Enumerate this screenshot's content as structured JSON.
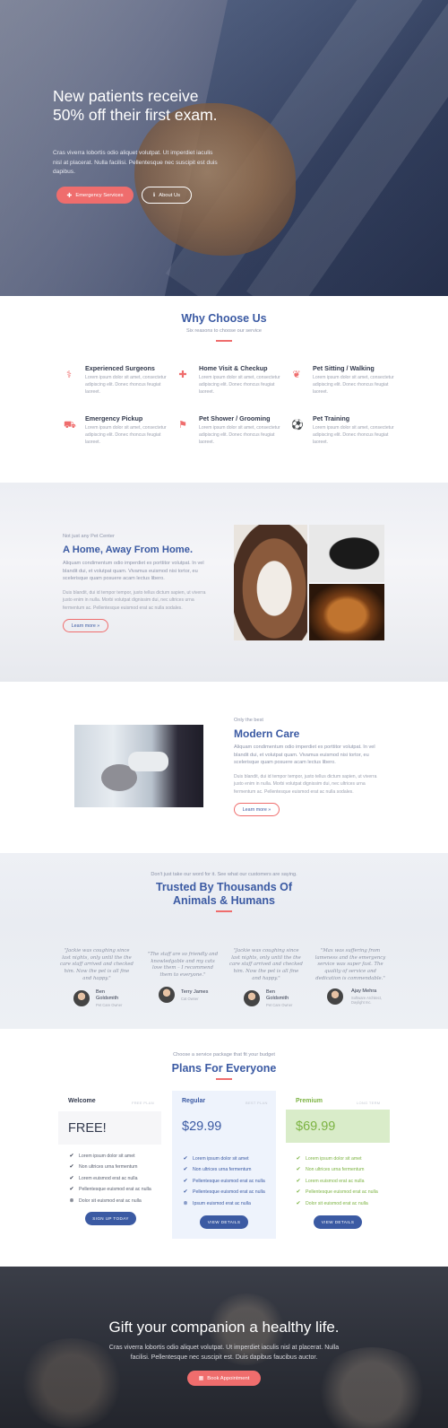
{
  "hero": {
    "title": "New patients receive 50% off their first exam.",
    "text": "Cras viverra lobortis odio aliquet volutpat. Ut imperdiet iaculis nisl at placerat. Nulla facilisi. Pellentesque nec suscipit est duis dapibus.",
    "btn_primary": "Emergency Services",
    "btn_secondary": "About Us"
  },
  "why": {
    "title": "Why Choose Us",
    "subtitle": "Six reasons to choose our service",
    "features": [
      {
        "icon": "stethoscope-icon",
        "title": "Experienced Surgeons",
        "text": "Lorem ipsum dolor sit amet, consectetur adipiscing elit. Donec rhoncus feugiat laoreet."
      },
      {
        "icon": "medical-kit-icon",
        "title": "Home Visit & Checkup",
        "text": "Lorem ipsum dolor sit amet, consectetur adipiscing elit. Donec rhoncus feugiat laoreet."
      },
      {
        "icon": "paw-icon",
        "title": "Pet Sitting / Walking",
        "text": "Lorem ipsum dolor sit amet, consectetur adipiscing elit. Donec rhoncus feugiat laoreet."
      },
      {
        "icon": "ambulance-icon",
        "title": "Emergency Pickup",
        "text": "Lorem ipsum dolor sit amet, consectetur adipiscing elit. Donec rhoncus feugiat laoreet."
      },
      {
        "icon": "shower-icon",
        "title": "Pet Shower / Grooming",
        "text": "Lorem ipsum dolor sit amet, consectetur adipiscing elit. Donec rhoncus feugiat laoreet."
      },
      {
        "icon": "ball-icon",
        "title": "Pet Training",
        "text": "Lorem ipsum dolor sit amet, consectetur adipiscing elit. Donec rhoncus feugiat laoreet."
      }
    ]
  },
  "home": {
    "eyebrow": "Not just any Pet Center",
    "title": "A Home, Away From Home.",
    "text1": "Aliquam condimentum odio imperdiet ex porttitor volutpat. In vel blandit dui, et volutpat quam. Vivamus euismod nisi tortor, eu scelerisque quam posuere acam lectus libero.",
    "text2": "Duis blandit, dui id tempor tempor, justo tellus dictum sapien, ut viverra justo enim in nulla. Morbi volutpat dignissim dui, nec ultrices urna fermentum ac. Pellentesque euismod erat ac nulla sodales.",
    "button": "Learn more »"
  },
  "care": {
    "eyebrow": "Only the best",
    "title": "Modern Care",
    "text1": "Aliquam condimentum odio imperdiet ex porttitor volutpat. In vel blandit dui, et volutpat quam. Vivamus euismod nisi tortor, eu scelerisque quam posuere acam lectus libero.",
    "text2": "Duis blandit, dui id tempor tempor, justo tellus dictum sapien, ut viverra justo enim in nulla. Morbi volutpat dignissim dui, nec ultrices urna fermentum ac. Pellentesque euismod erat ac nulla sodales.",
    "button": "Learn more »"
  },
  "trusted": {
    "eyebrow": "Don't just take our word for it. See what our customers are saying.",
    "title_line1": "Trusted By Thousands Of",
    "title_line2": "Animals & Humans",
    "testimonials": [
      {
        "quote": "\"Jackie was coughing since last nights, only until the the care staff arrived and checked him. Now the pet is all fine and happy.\"",
        "name": "Ben Goldsmith",
        "role": "Pet Care Owner"
      },
      {
        "quote": "\"The staff are so friendly and knowledgable and my cats love them – I recommend them to everyone.\"",
        "name": "Terry James",
        "role": "Cat Owner"
      },
      {
        "quote": "\"Jackie was coughing since last nights, only until the the care staff arrived and checked him. Now the pet is all fine and happy.\"",
        "name": "Ben Goldsmith",
        "role": "Pet Care Owner"
      },
      {
        "quote": "\"Max was suffering from lameness and the emergency service was super fast. The quality of service and dedication is commendable.\"",
        "name": "Ajay Mehra",
        "role": "Software Architect, Daylight Inc."
      }
    ]
  },
  "pricing": {
    "eyebrow": "Choose a service package that fit your budget",
    "title": "Plans For Everyone",
    "plans": [
      {
        "name": "Welcome",
        "tag": "FREE PLAN",
        "price": "FREE!",
        "button": "SIGN UP TODAY",
        "items": [
          "Lorem ipsum dolor sit amet",
          "Non ultrices urna fermentum",
          "Lorem euismod erat ac nulla",
          "Pellentesque euismod erat ac nulla",
          "Dolor sit euismod erat ac nulla"
        ]
      },
      {
        "name": "Regular",
        "tag": "BEST PLAN",
        "price": "$29.99",
        "button": "VIEW DETAILS",
        "items": [
          "Lorem ipsum dolor sit amet",
          "Non ultrices urna fermentum",
          "Pellentesque euismod erat ac nulla",
          "Pellentesque euismod erat ac nulla",
          "Ipsum euismod erat ac nulla"
        ]
      },
      {
        "name": "Premium",
        "tag": "LONG TERM",
        "price": "$69.99",
        "button": "VIEW DETAILS",
        "items": [
          "Lorem ipsum dolor sit amet",
          "Non ultrices urna fermentum",
          "Lorem euismod erat ac nulla",
          "Pellentesque euismod erat ac nulla",
          "Dolor sit euismod erat ac nulla"
        ]
      }
    ]
  },
  "cta": {
    "title": "Gift your companion a healthy life.",
    "text": "Cras viverra lobortis odio aliquet volutpat. Ut imperdiet iaculis nisl at placerat. Nulla facilisi. Pellentesque nec suscipit est. Duis dapibus faucibus auctor.",
    "button": "Book Appointment"
  },
  "colors": {
    "brand": "#3b5aa3",
    "accent": "#ef6d6d",
    "premium": "#7cb342",
    "premium_bg": "#d9ecc9",
    "regular_bg": "#eef3fc"
  }
}
